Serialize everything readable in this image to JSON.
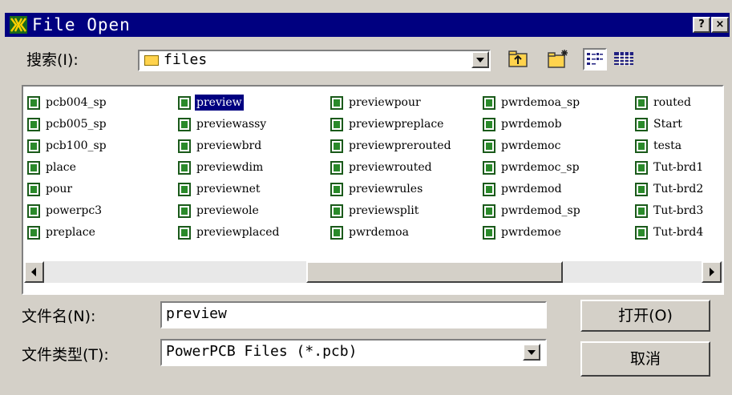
{
  "window": {
    "title": "File Open",
    "help_label": "?",
    "close_label": "×"
  },
  "lookin": {
    "label": "搜索(I):",
    "value": "files"
  },
  "files": {
    "selected": "preview",
    "columns": [
      [
        "pcb004_sp",
        "pcb005_sp",
        "pcb100_sp",
        "place",
        "pour",
        "powerpc3",
        "preplace"
      ],
      [
        "preview",
        "previewassy",
        "previewbrd",
        "previewdim",
        "previewnet",
        "previewole",
        "previewplaced"
      ],
      [
        "previewpour",
        "previewpreplace",
        "previewprerouted",
        "previewrouted",
        "previewrules",
        "previewsplit",
        "pwrdemoa"
      ],
      [
        "pwrdemoa_sp",
        "pwrdemob",
        "pwrdemoc",
        "pwrdemoc_sp",
        "pwrdemod",
        "pwrdemod_sp",
        "pwrdemoe"
      ],
      [
        "routed",
        "Start",
        "testa",
        "Tut-brd1",
        "Tut-brd2",
        "Tut-brd3",
        "Tut-brd4"
      ]
    ]
  },
  "filename": {
    "label": "文件名(N):",
    "value": "preview"
  },
  "filetype": {
    "label": "文件类型(T):",
    "value": "PowerPCB Files (*.pcb)"
  },
  "buttons": {
    "open": "打开(O)",
    "cancel": "取消"
  },
  "icons": [
    "app-icon",
    "folder-icon",
    "up-folder-icon",
    "new-folder-icon",
    "list-view-icon",
    "details-view-icon",
    "pcb-file-icon"
  ],
  "colors": {
    "titlebar": "#000080",
    "face": "#d4d0c8",
    "selection": "#000080"
  }
}
